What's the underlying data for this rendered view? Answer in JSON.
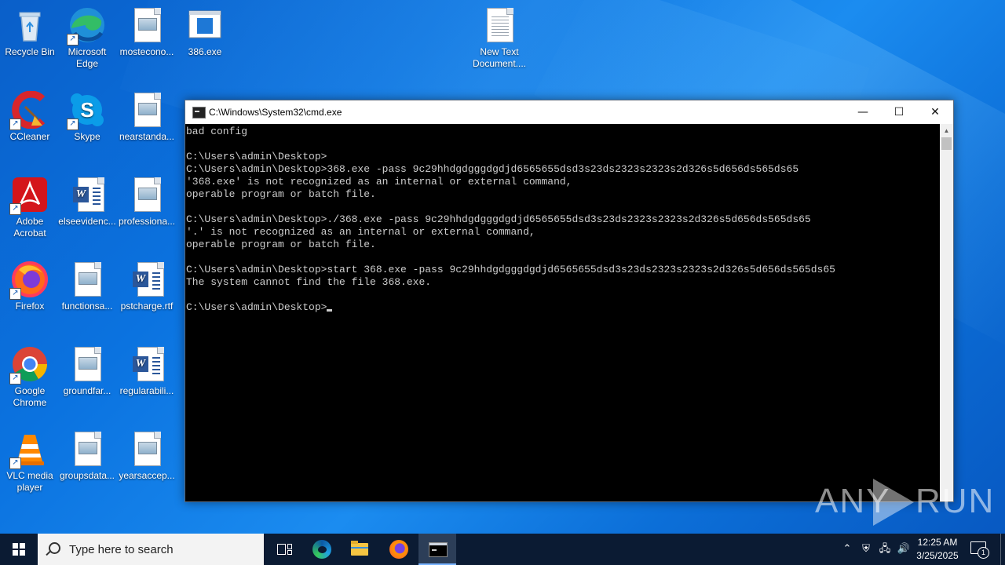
{
  "desktop": {
    "icons": [
      {
        "label": "Recycle Bin"
      },
      {
        "label": "Microsoft Edge"
      },
      {
        "label": "mosteconο..."
      },
      {
        "label": "386.exe"
      },
      {
        "label": "New Text Document...."
      },
      {
        "label": "CCleaner"
      },
      {
        "label": "Skype"
      },
      {
        "label": "nearstanda..."
      },
      {
        "label": "Adobe Acrobat"
      },
      {
        "label": "elseevidenc..."
      },
      {
        "label": "professiona..."
      },
      {
        "label": "Firefox"
      },
      {
        "label": "functionsa..."
      },
      {
        "label": "pstcharge.rtf"
      },
      {
        "label": "Google Chrome"
      },
      {
        "label": "groundfar..."
      },
      {
        "label": "regularabili..."
      },
      {
        "label": "VLC media player"
      },
      {
        "label": "groupsdata..."
      },
      {
        "label": "yearsaccep..."
      }
    ]
  },
  "cmd": {
    "title": "C:\\Windows\\System32\\cmd.exe",
    "minimize": "—",
    "maximize": "☐",
    "close": "✕",
    "lines": [
      "bad config",
      "",
      "C:\\Users\\admin\\Desktop>",
      "C:\\Users\\admin\\Desktop>368.exe -pass 9c29hhdgdgggdgdjd6565655dsd3s23ds2323s2323s2d326s5d656ds565ds65",
      "'368.exe' is not recognized as an internal or external command,",
      "operable program or batch file.",
      "",
      "C:\\Users\\admin\\Desktop>./368.exe -pass 9c29hhdgdgggdgdjd6565655dsd3s23ds2323s2323s2d326s5d656ds565ds65",
      "'.' is not recognized as an internal or external command,",
      "operable program or batch file.",
      "",
      "C:\\Users\\admin\\Desktop>start 368.exe -pass 9c29hhdgdgggdgdjd6565655dsd3s23ds2323s2323s2d326s5d656ds565ds65",
      "The system cannot find the file 368.exe.",
      "",
      "C:\\Users\\admin\\Desktop>"
    ]
  },
  "watermark": {
    "left": "ANY",
    "right": "RUN"
  },
  "taskbar": {
    "search_placeholder": "Type here to search",
    "time": "12:25 AM",
    "date": "3/25/2025",
    "notifications_count": "1"
  },
  "colors": {
    "desktop_blue": "#0b73e0",
    "taskbar": "#0b1b33",
    "console_text": "#cccccc"
  }
}
